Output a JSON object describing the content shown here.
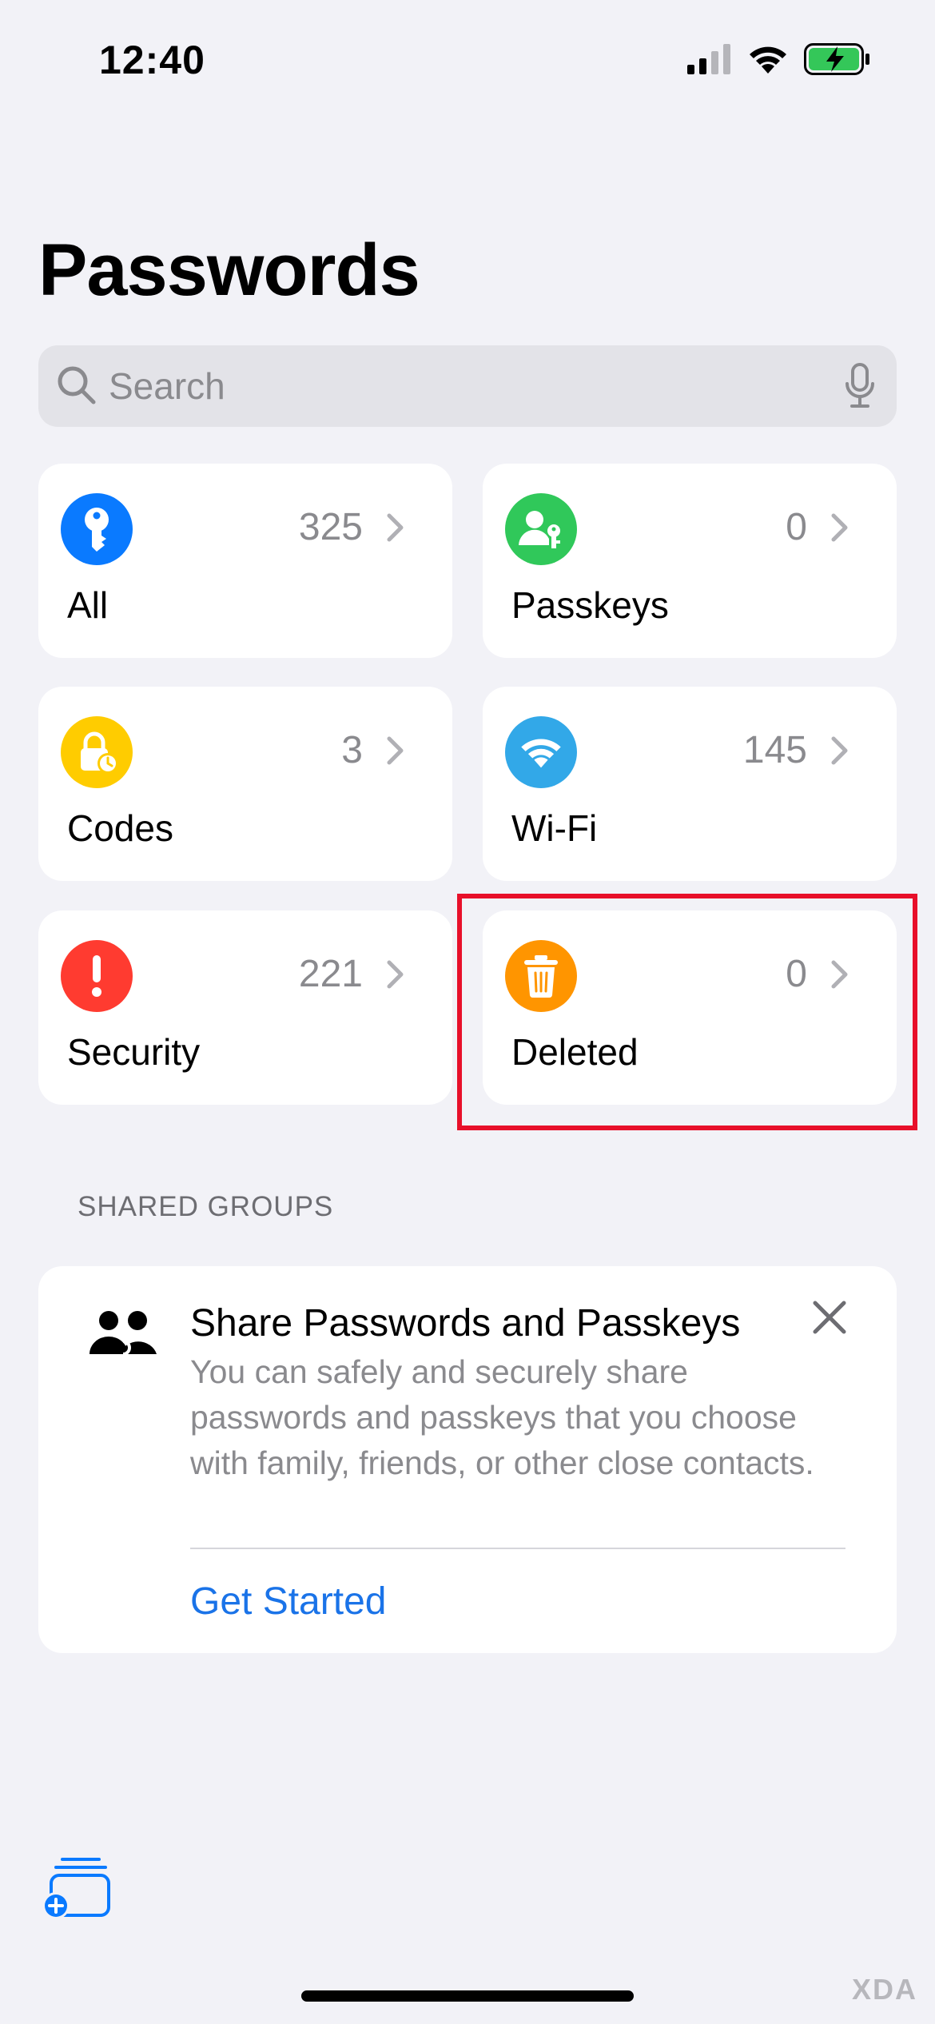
{
  "status_bar": {
    "time": "12:40"
  },
  "header": {
    "title": "Passwords"
  },
  "search": {
    "placeholder": "Search"
  },
  "categories": [
    {
      "label": "All",
      "count": "325",
      "icon": "key-icon",
      "color": "#0a7aff"
    },
    {
      "label": "Passkeys",
      "count": "0",
      "icon": "person-key-icon",
      "color": "#30c85a"
    },
    {
      "label": "Codes",
      "count": "3",
      "icon": "lock-clock-icon",
      "color": "#ffcc00"
    },
    {
      "label": "Wi-Fi",
      "count": "145",
      "icon": "wifi-icon",
      "color": "#32a8e8"
    },
    {
      "label": "Security",
      "count": "221",
      "icon": "exclamation-icon",
      "color": "#ff3b30"
    },
    {
      "label": "Deleted",
      "count": "0",
      "icon": "trash-icon",
      "color": "#ff9500"
    }
  ],
  "shared_groups": {
    "header": "SHARED GROUPS",
    "title": "Share Passwords and Passkeys",
    "body": "You can safely and securely share passwords and passkeys that you choose with family, friends, or other close contacts.",
    "action": "Get Started"
  },
  "colors": {
    "accent": "#1a73e8",
    "highlight": "#e8102a"
  },
  "watermark": "XDA"
}
